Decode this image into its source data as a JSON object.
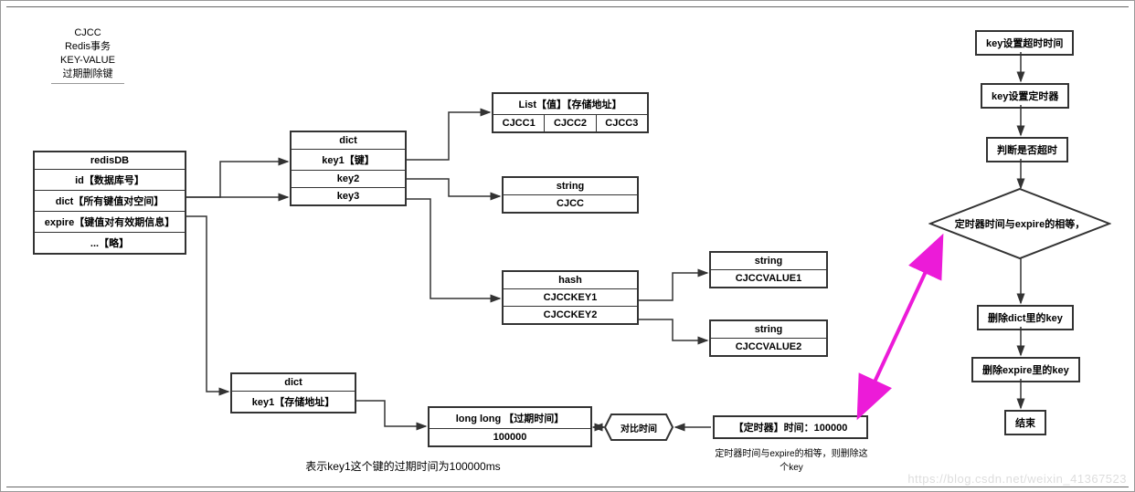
{
  "header": {
    "l1": "CJCC",
    "l2": "Redis事务",
    "l3": "KEY-VALUE",
    "l4": "过期删除键"
  },
  "redisDB": {
    "title": "redisDB",
    "r1": "id【数据库号】",
    "r2": "dict【所有键值对空间】",
    "r3": "expire【键值对有效期信息】",
    "r4": "...【略】"
  },
  "dict1": {
    "title": "dict",
    "k1": "key1【键】",
    "k2": "key2",
    "k3": "key3"
  },
  "list": {
    "title": "List【值】【存储地址】",
    "c1": "CJCC1",
    "c2": "CJCC2",
    "c3": "CJCC3"
  },
  "str1": {
    "title": "string",
    "v": "CJCC"
  },
  "hash": {
    "title": "hash",
    "k1": "CJCCKEY1",
    "k2": "CJCCKEY2"
  },
  "str2": {
    "title": "string",
    "v": "CJCCVALUE1"
  },
  "str3": {
    "title": "string",
    "v": "CJCCVALUE2"
  },
  "dict2": {
    "title": "dict",
    "k1": "key1【存储地址】"
  },
  "longlong": {
    "title": "long long 【过期时间】",
    "v": "100000"
  },
  "hex": {
    "label": "对比时间"
  },
  "timer": {
    "label": "【定时器】时间：100000"
  },
  "caption1": "表示key1这个键的过期时间为100000ms",
  "caption2": "定时器时间与expire的相等，则删除这个key",
  "flow": {
    "s1": "key设置超时时间",
    "s2": "key设置定时器",
    "s3": "判断是否超时",
    "d1": "定时器时间与expire的相等，",
    "s4": "删除dict里的key",
    "s5": "删除expire里的key",
    "s6": "结束"
  },
  "watermark": "https://blog.csdn.net/weixin_41367523",
  "hrTop": "—",
  "hrBot": "—"
}
